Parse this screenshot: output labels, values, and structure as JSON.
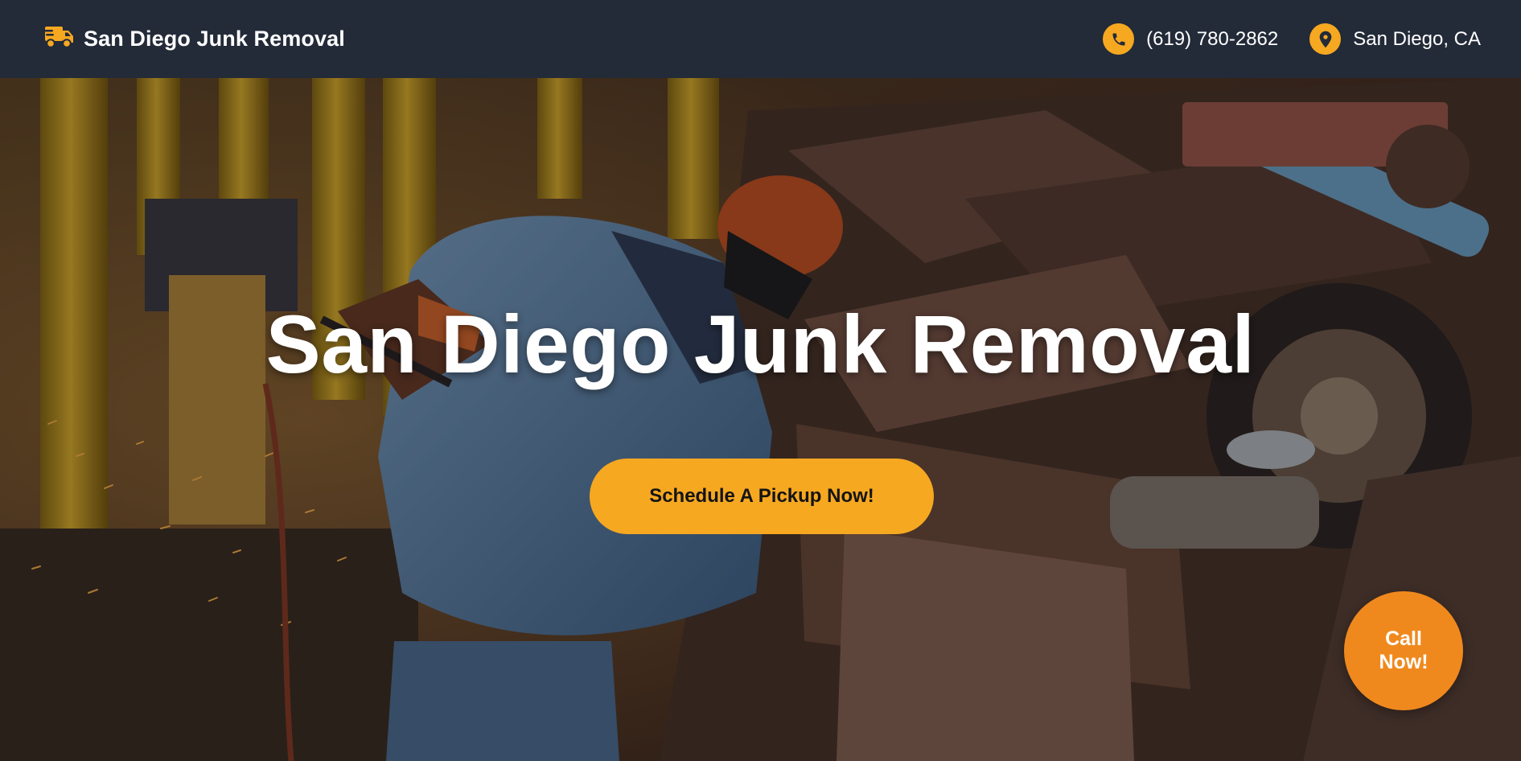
{
  "header": {
    "brand": {
      "icon": "truck-icon",
      "name": "San Diego Junk Removal"
    },
    "phone": {
      "icon": "phone-icon",
      "label": "(619) 780-2862"
    },
    "location": {
      "icon": "map-pin-icon",
      "label": "San Diego, CA"
    }
  },
  "hero": {
    "background": "photo: worker in hard hat grinding metal in a scrap yard",
    "title": "San Diego Junk Removal",
    "cta_label": "Schedule A Pickup Now!"
  },
  "floating": {
    "call_label": "Call Now!"
  },
  "colors": {
    "header_bg": "#232a38",
    "accent": "#f6a821",
    "call_button": "#f0891d",
    "text_light": "#ffffff",
    "text_dark": "#141414"
  }
}
